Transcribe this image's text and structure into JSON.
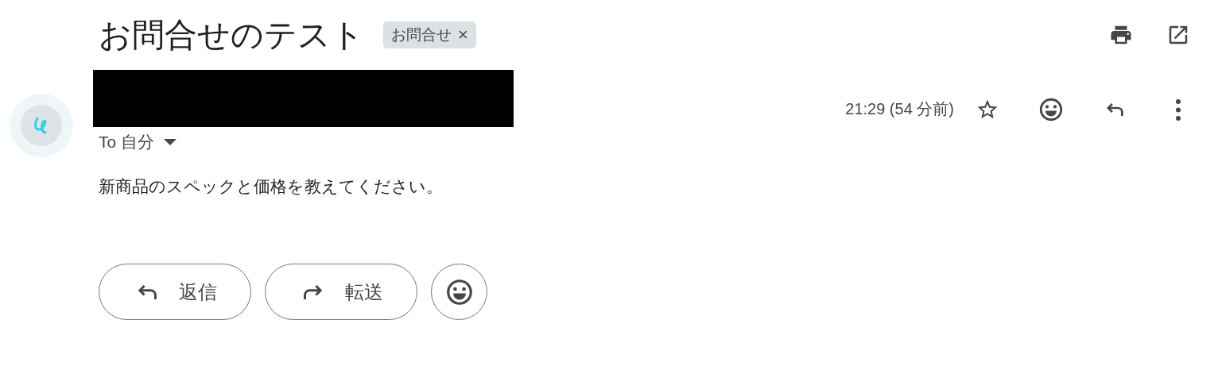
{
  "subject": "お問合せのテスト",
  "label": {
    "text": "お問合せ",
    "remove": "×"
  },
  "sender": {
    "redacted": true
  },
  "recipient": "To 自分",
  "time": "21:29 (54 分前)",
  "starred": false,
  "body": "新商品のスペックと価格を教えてください。",
  "actions": [
    {
      "kind": "reply",
      "label": "返信"
    },
    {
      "kind": "forward",
      "label": "転送"
    },
    {
      "kind": "emoji"
    }
  ]
}
